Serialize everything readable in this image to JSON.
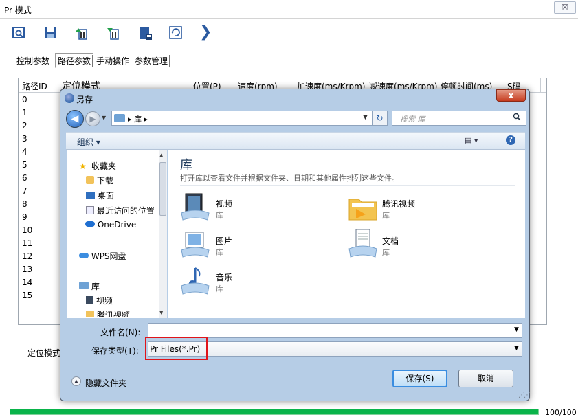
{
  "window": {
    "title": "Pr 模式",
    "close_glyph": "☒"
  },
  "toolbar": {
    "icons": [
      "preview-icon",
      "save-disk-icon",
      "upload-icon",
      "download-icon",
      "save-file-icon",
      "reload-icon",
      "arrow-right-icon"
    ],
    "more_glyph": "❯"
  },
  "tabs": [
    "控制参数",
    "路径参数",
    "手动操作",
    "参数管理"
  ],
  "active_tab": "路径参数",
  "table": {
    "headers": [
      "路径ID",
      "定位模式",
      "位置(P)",
      "速度(rpm)",
      "加速度(ms/Krpm)",
      "减速度(ms/Krpm)",
      "停顿时间(ms)",
      "S码"
    ],
    "row_ids": [
      "0",
      "1",
      "2",
      "3",
      "4",
      "5",
      "6",
      "7",
      "8",
      "9",
      "10",
      "11",
      "12",
      "13",
      "14",
      "15"
    ]
  },
  "lower_panel": {
    "label": "定位模式"
  },
  "progress": {
    "value": 100,
    "max": 100,
    "text": "100/100"
  },
  "dialog": {
    "title": "另存",
    "close_label": "x",
    "address": {
      "path": "▸ 库 ▸",
      "search_placeholder": "搜索 库"
    },
    "command_bar": {
      "organize": "组织 ▾",
      "view": "▤ ▾",
      "help": "?"
    },
    "nav": [
      {
        "label": "收藏夹",
        "icon": "star-icon"
      },
      {
        "label": "下载",
        "icon": "download-folder-icon"
      },
      {
        "label": "桌面",
        "icon": "desktop-icon"
      },
      {
        "label": "最近访问的位置",
        "icon": "recent-places-icon"
      },
      {
        "label": "OneDrive",
        "icon": "cloud-icon"
      },
      {
        "label": "WPS网盘",
        "icon": "wps-cloud-icon"
      },
      {
        "label": "库",
        "icon": "library-icon"
      },
      {
        "label": "视频",
        "icon": "video-library-icon"
      },
      {
        "label": "腾讯视频",
        "icon": "tencent-video-folder-icon"
      }
    ],
    "library": {
      "title": "库",
      "description": "打开库以查看文件并根据文件夹、日期和其他属性排列这些文件。",
      "items": [
        {
          "name": "视频",
          "sub": "库",
          "icon": "video-library-icon"
        },
        {
          "name": "腾讯视频",
          "sub": "库",
          "icon": "tencent-video-folder-icon"
        },
        {
          "name": "图片",
          "sub": "库",
          "icon": "picture-library-icon"
        },
        {
          "name": "文档",
          "sub": "库",
          "icon": "document-library-icon"
        },
        {
          "name": "音乐",
          "sub": "库",
          "icon": "music-library-icon"
        }
      ]
    },
    "filename": {
      "label": "文件名(N):",
      "value": ""
    },
    "filetype": {
      "label": "保存类型(T):",
      "value": "Pr Files(*.Pr)"
    },
    "hide_folders": "隐藏文件夹",
    "save_button": "保存(S)",
    "cancel_button": "取消"
  },
  "colors": {
    "accent": "#2c62a8",
    "progress": "#0ab44a",
    "highlight": "#e0141a"
  }
}
